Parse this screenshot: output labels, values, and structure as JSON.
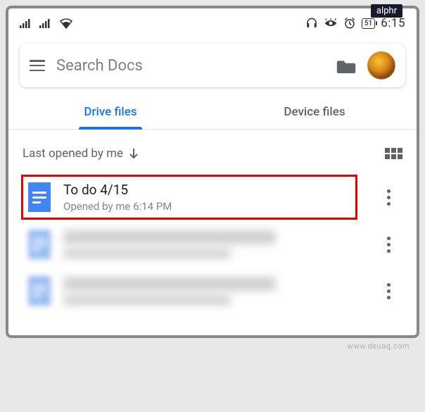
{
  "badge": "alphr",
  "statusbar": {
    "battery": "51",
    "time": "6:15"
  },
  "search": {
    "placeholder": "Search Docs"
  },
  "tabs": {
    "drive": "Drive files",
    "device": "Device files"
  },
  "sort": {
    "label": "Last opened by me"
  },
  "files": [
    {
      "title": "To do 4/15",
      "subtitle": "Opened by me 6:14 PM",
      "highlighted": true
    },
    {
      "title": "",
      "subtitle": "",
      "blurred": true
    },
    {
      "title": "",
      "subtitle": "",
      "blurred": true
    }
  ],
  "watermark": "www.deuaq.com"
}
